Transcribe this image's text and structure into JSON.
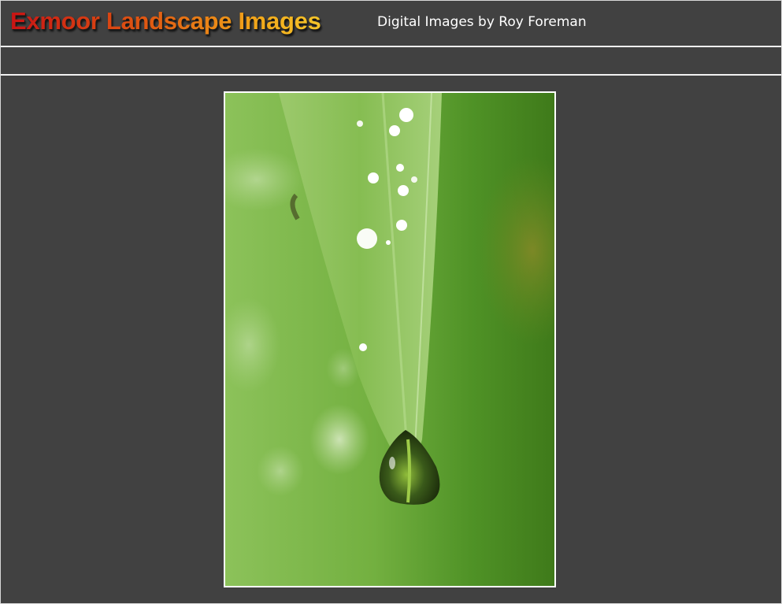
{
  "header": {
    "title": "Exmoor Landscape Images",
    "subtitle": "Digital Images by Roy Foreman"
  },
  "main": {
    "photo": {
      "subject": "water-droplet-on-grass-blade"
    }
  },
  "colors": {
    "background": "#414141",
    "rule": "#f2f2f2",
    "title_gradient_start": "#c81414",
    "title_gradient_end": "#f5c52a",
    "subtitle": "#ffffff"
  }
}
